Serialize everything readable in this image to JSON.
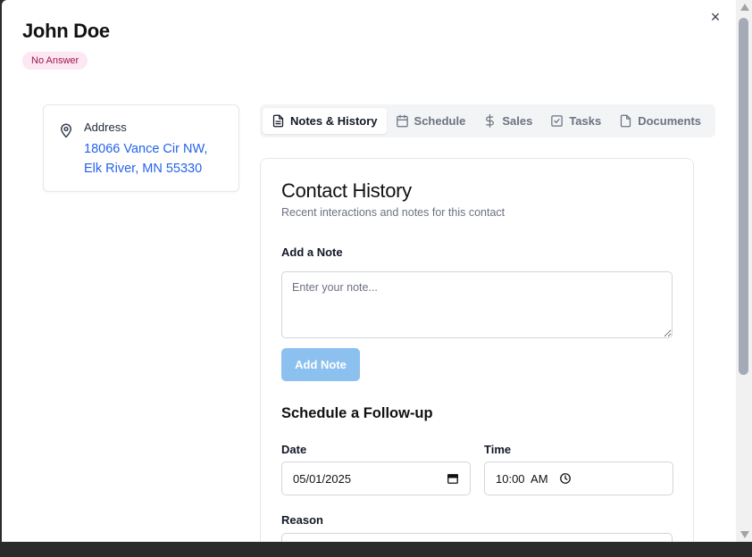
{
  "modal": {
    "title": "John Doe",
    "status_badge": "No Answer",
    "close_glyph": "×"
  },
  "address": {
    "label": "Address",
    "line1": "18066 Vance Cir NW,",
    "line2": "Elk River, MN 55330",
    "icon": "map-pin-icon"
  },
  "tabs": [
    {
      "label": "Notes & History",
      "icon": "document-icon",
      "active": true
    },
    {
      "label": "Schedule",
      "icon": "calendar-icon",
      "active": false
    },
    {
      "label": "Sales",
      "icon": "dollar-icon",
      "active": false
    },
    {
      "label": "Tasks",
      "icon": "checkbox-icon",
      "active": false
    },
    {
      "label": "Documents",
      "icon": "file-icon",
      "active": false
    }
  ],
  "history": {
    "title": "Contact History",
    "subtitle": "Recent interactions and notes for this contact",
    "note_label": "Add a Note",
    "note_placeholder": "Enter your note...",
    "add_button": "Add Note",
    "followup_title": "Schedule a Follow-up",
    "date_label": "Date",
    "date_value": "05/01/2025",
    "time_label": "Time",
    "time_value": "10:00  AM",
    "reason_label": "Reason"
  },
  "colors": {
    "link": "#2563eb",
    "badge_bg": "#fce7f3",
    "badge_text": "#9d174d",
    "button_disabled": "#8cc0ef"
  }
}
